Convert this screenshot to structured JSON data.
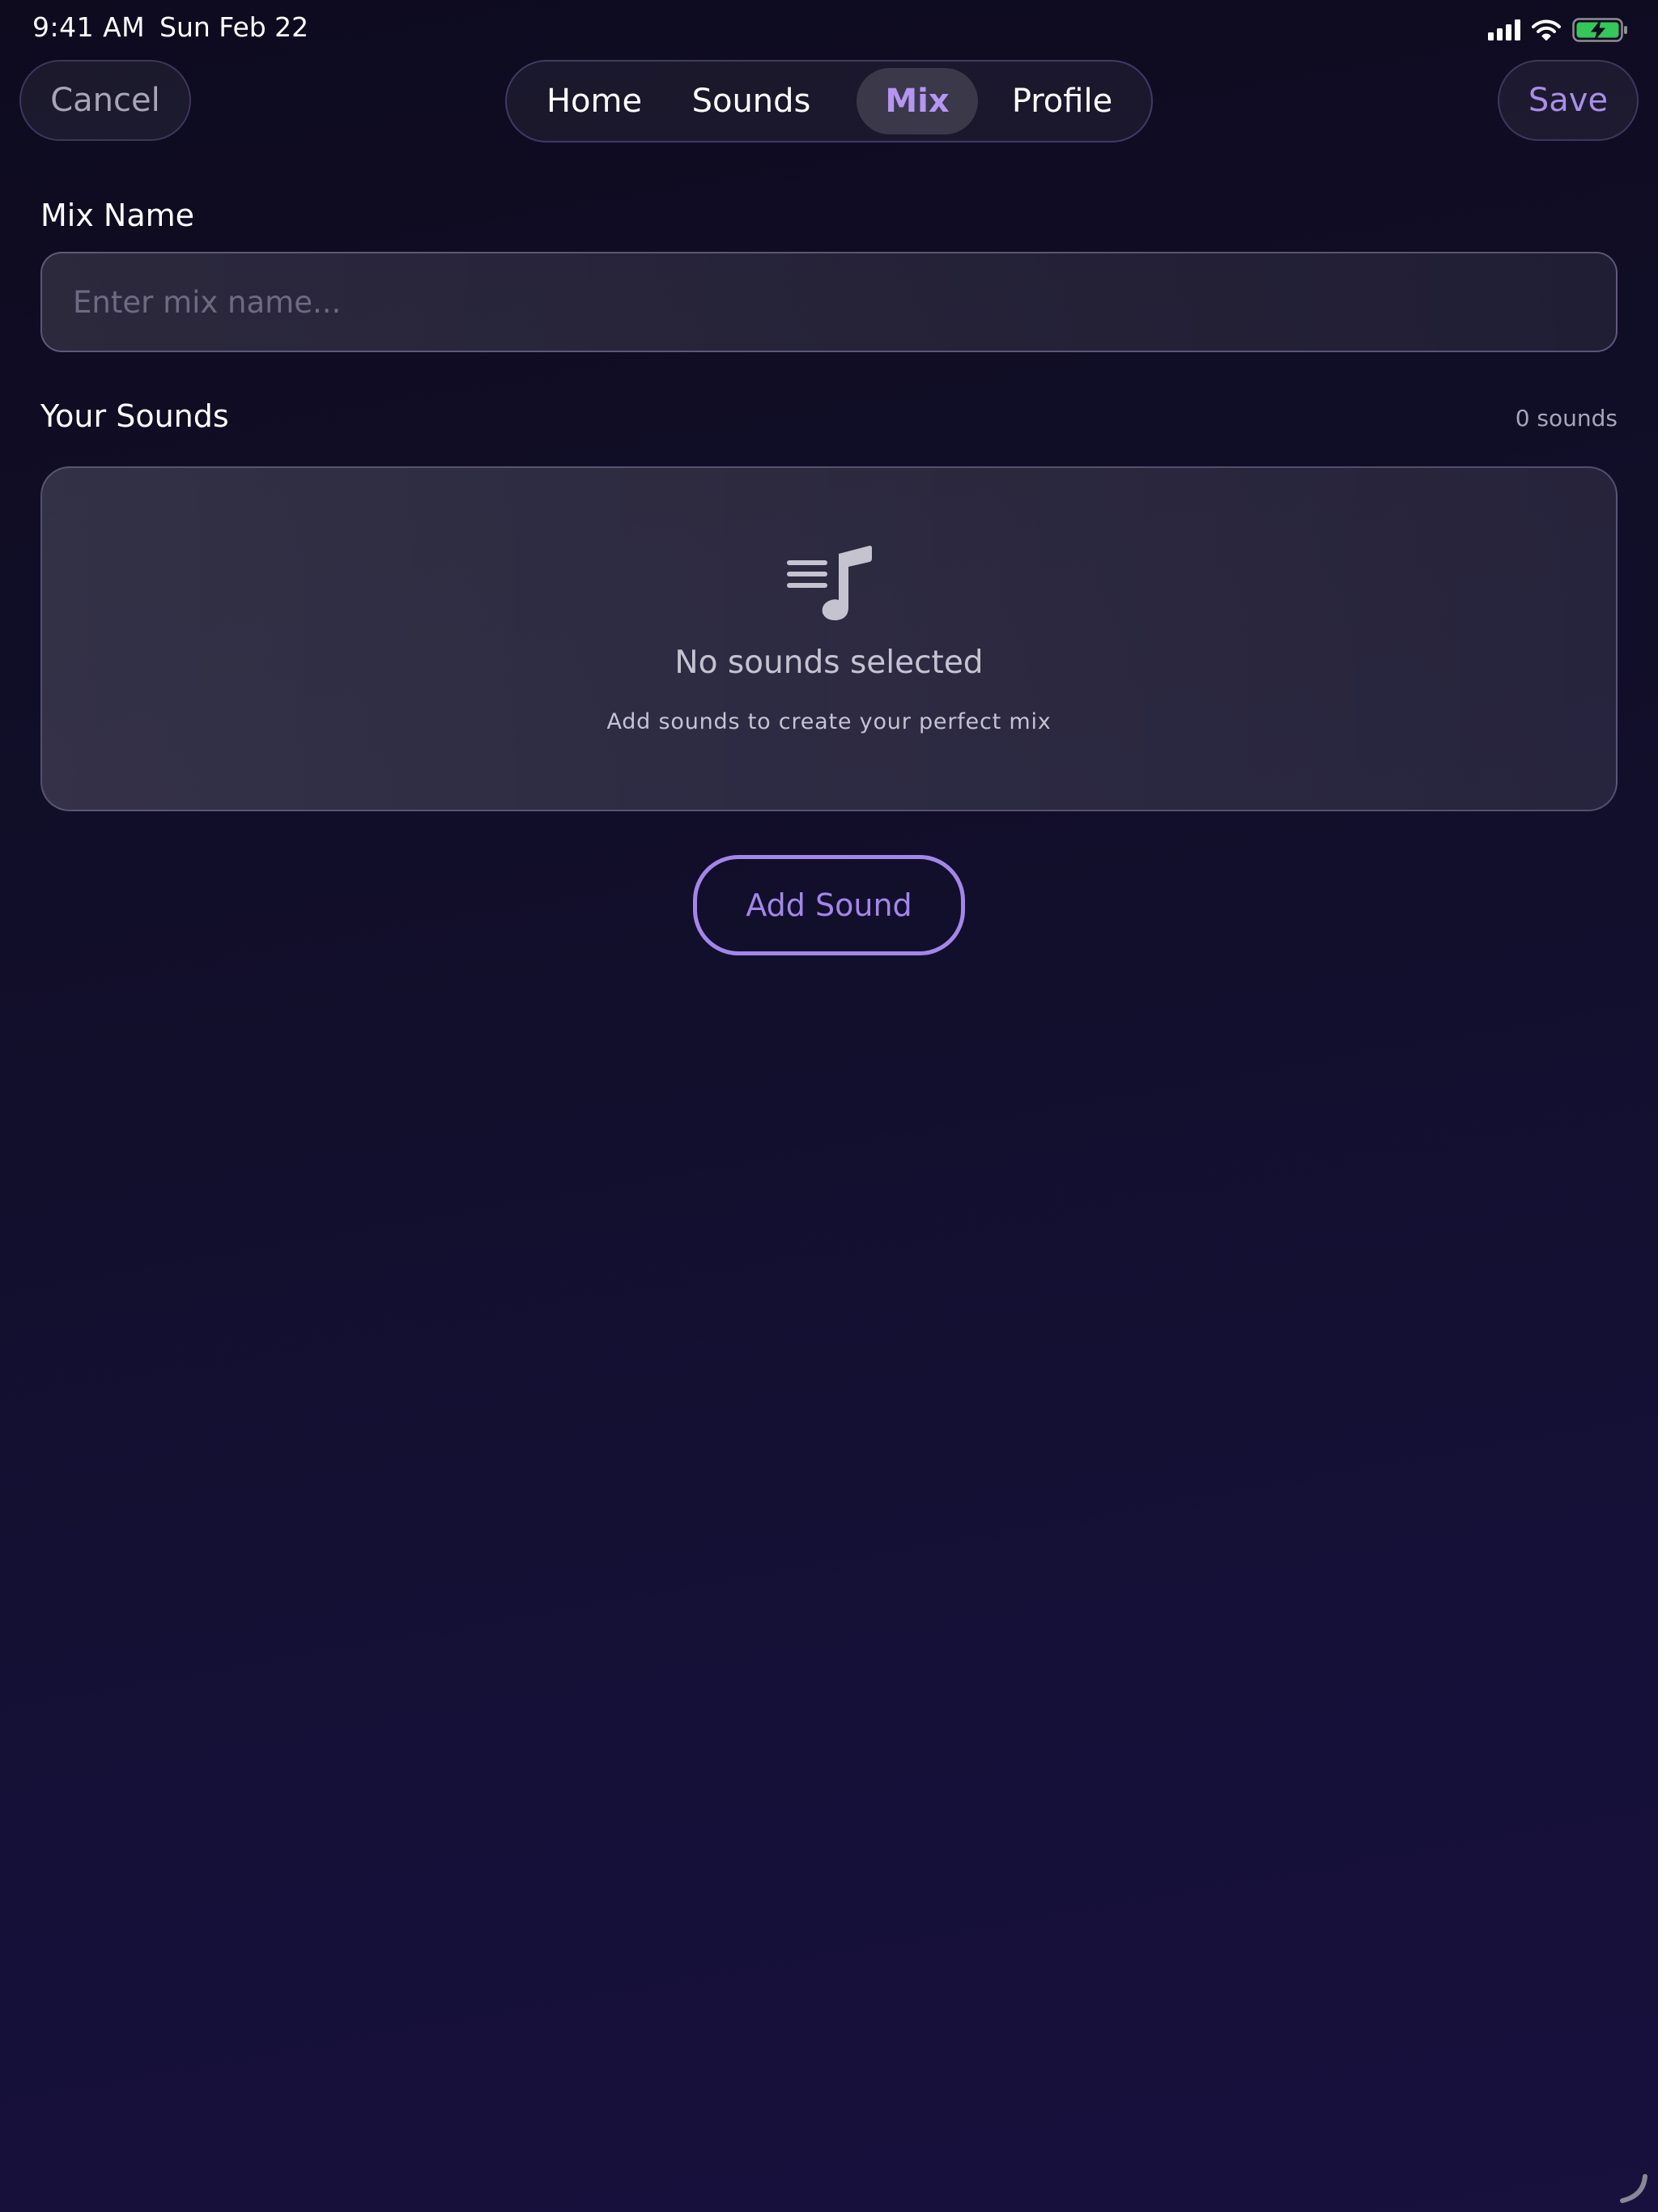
{
  "status_bar": {
    "time": "9:41 AM",
    "date": "Sun Feb 22",
    "icons": [
      "cellular-signal-icon",
      "wifi-icon",
      "battery-charging-icon"
    ]
  },
  "nav": {
    "cancel_label": "Cancel",
    "save_label": "Save",
    "tabs": [
      {
        "label": "Home",
        "active": false
      },
      {
        "label": "Sounds",
        "active": false
      },
      {
        "label": "Mix",
        "active": true
      },
      {
        "label": "Profile",
        "active": false
      }
    ]
  },
  "mix_name": {
    "label": "Mix Name",
    "value": "",
    "placeholder": "Enter mix name..."
  },
  "sounds": {
    "label": "Your Sounds",
    "count_text": "0 sounds",
    "empty_icon": "music-note-list-icon",
    "empty_title": "No sounds selected",
    "empty_subtitle": "Add sounds to create your perfect mix",
    "add_button_label": "Add Sound"
  },
  "colors": {
    "accent": "#a386ea",
    "active_tab_text": "#b496f2",
    "battery_green": "#34c759",
    "background_top": "#0e0b1f",
    "background_bottom": "#18103d"
  }
}
